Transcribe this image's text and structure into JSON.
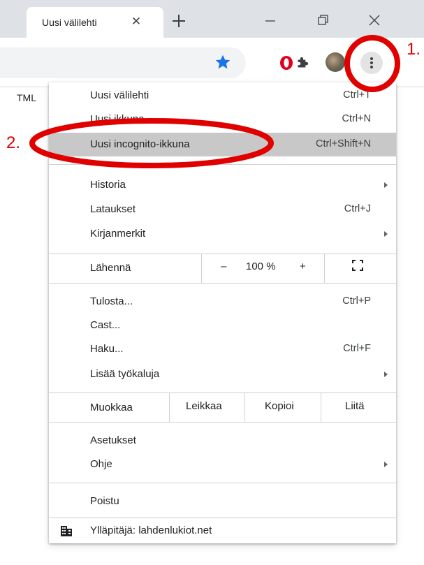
{
  "tab": {
    "title": "Uusi välilehti"
  },
  "behind": {
    "text": "TML"
  },
  "menu": {
    "items": [
      {
        "label": "Uusi välilehti",
        "shortcut": "Ctrl+T"
      },
      {
        "label": "Uusi ikkuna",
        "shortcut": "Ctrl+N"
      },
      {
        "label": "Uusi incognito-ikkuna",
        "shortcut": "Ctrl+Shift+N"
      },
      {
        "label": "Historia",
        "shortcut": ""
      },
      {
        "label": "Lataukset",
        "shortcut": "Ctrl+J"
      },
      {
        "label": "Kirjanmerkit",
        "shortcut": ""
      },
      {
        "label": "Tulosta...",
        "shortcut": "Ctrl+P"
      },
      {
        "label": "Cast...",
        "shortcut": ""
      },
      {
        "label": "Haku...",
        "shortcut": "Ctrl+F"
      },
      {
        "label": "Lisää työkaluja",
        "shortcut": ""
      },
      {
        "label": "Asetukset",
        "shortcut": ""
      },
      {
        "label": "Ohje",
        "shortcut": ""
      },
      {
        "label": "Poistu",
        "shortcut": ""
      }
    ],
    "zoom": {
      "label": "Lähennä",
      "minus": "–",
      "value": "100 %",
      "plus": "+"
    },
    "edit": {
      "label": "Muokkaa",
      "cut": "Leikkaa",
      "copy": "Kopioi",
      "paste": "Liitä"
    },
    "managed": {
      "text": "Ylläpitäjä: lahdenlukiot.net"
    }
  },
  "annotations": {
    "step1": "1.",
    "step2": "2."
  },
  "colors": {
    "annotation_red": "#e00000",
    "highlight": "#c8c8c8",
    "star_blue": "#1a73e8",
    "opera_red": "#e0001b"
  },
  "icons": [
    "close-icon",
    "plus-icon",
    "minimize-icon",
    "restore-icon",
    "window-close-icon",
    "star-icon",
    "opera-icon",
    "puzzle-icon",
    "avatar",
    "kebab-menu-icon",
    "fullscreen-icon",
    "building-icon"
  ]
}
